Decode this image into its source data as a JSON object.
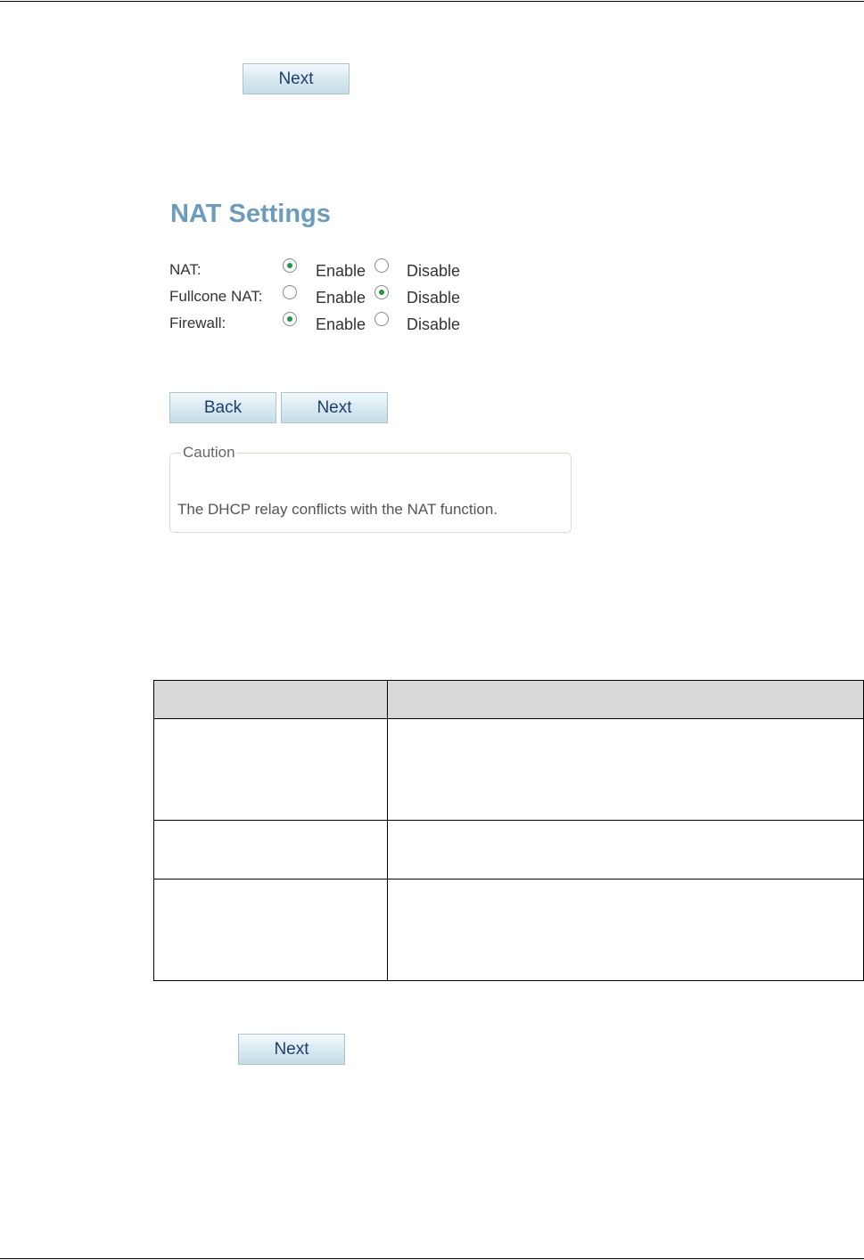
{
  "step1": {
    "next_label": "Next"
  },
  "nat_settings": {
    "title": "NAT Settings",
    "rows": [
      {
        "label": "NAT:",
        "enable_label": "Enable",
        "disable_label": "Disable",
        "selected": "Enable"
      },
      {
        "label": "Fullcone NAT:",
        "enable_label": "Enable",
        "disable_label": "Disable",
        "selected": "Disable"
      },
      {
        "label": "Firewall:",
        "enable_label": "Enable",
        "disable_label": "Disable",
        "selected": "Enable"
      }
    ],
    "back_label": "Back",
    "next_label": "Next",
    "caution": {
      "legend": "Caution",
      "message": "The DHCP relay conflicts with the NAT function."
    }
  },
  "description_table": {
    "header": [
      "",
      ""
    ],
    "rows": [
      [
        "",
        ""
      ],
      [
        "",
        ""
      ],
      [
        "",
        ""
      ]
    ]
  },
  "step3": {
    "next_label": "Next"
  },
  "colors": {
    "title": "#6a9cc0",
    "button_text": "#1c3f6e",
    "radio_dot": "#1d9a3a",
    "table_header_bg": "#d9d9d9"
  }
}
